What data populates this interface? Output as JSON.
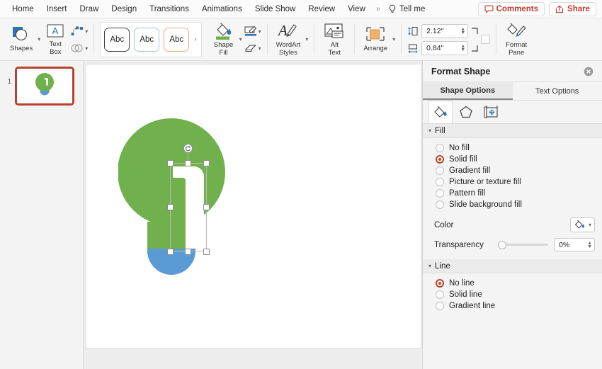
{
  "menubar": {
    "items": [
      {
        "label": "Home",
        "name": "menu-home"
      },
      {
        "label": "Insert",
        "name": "menu-insert"
      },
      {
        "label": "Draw",
        "name": "menu-draw"
      },
      {
        "label": "Design",
        "name": "menu-design"
      },
      {
        "label": "Transitions",
        "name": "menu-transitions"
      },
      {
        "label": "Animations",
        "name": "menu-animations"
      },
      {
        "label": "Slide Show",
        "name": "menu-slide-show"
      },
      {
        "label": "Review",
        "name": "menu-review"
      },
      {
        "label": "View",
        "name": "menu-view"
      }
    ],
    "overflow": "»",
    "tell_me": "Tell me",
    "comments": "Comments",
    "share": "Share",
    "accent_color": "#c0392b"
  },
  "ribbon": {
    "shapes_label": "Shapes",
    "textbox_label": "Text\nBox",
    "textbox_line1": "Text",
    "textbox_line2": "Box",
    "styles": [
      {
        "label": "Abc",
        "border": "#404040"
      },
      {
        "label": "Abc",
        "border": "#a8c3e0"
      },
      {
        "label": "Abc",
        "border": "#e8a87c"
      }
    ],
    "gallery_more": "›",
    "shape_fill_line1": "Shape",
    "shape_fill_line2": "Fill",
    "shape_fill_color": "#6fb04c",
    "wordart_line1": "WordArt",
    "wordart_line2": "Styles",
    "alt_text_line1": "Alt",
    "alt_text_line2": "Text",
    "arrange_label": "Arrange",
    "height_value": "2.12\"",
    "width_value": "0.84\"",
    "format_pane_line1": "Format",
    "format_pane_line2": "Pane"
  },
  "slide_panel": {
    "slide_number": "1",
    "selected_border_color": "#b8432a"
  },
  "canvas": {
    "bulb_green": "#70b04d",
    "bulb_blue": "#5b9bd5",
    "selection_border": "#b9b9b9"
  },
  "format_pane": {
    "title": "Format Shape",
    "close_icon": "close-icon",
    "tabs": [
      {
        "label": "Shape Options",
        "active": true
      },
      {
        "label": "Text Options",
        "active": false
      }
    ],
    "icon_tabs": [
      {
        "name": "fill-bucket-icon",
        "active": true
      },
      {
        "name": "pentagon-effects-icon",
        "active": false
      },
      {
        "name": "size-properties-icon",
        "active": false
      }
    ],
    "fill": {
      "section_title": "Fill",
      "caret": "⌄",
      "options": [
        {
          "label": "No fill",
          "selected": false
        },
        {
          "label": "Solid fill",
          "selected": true
        },
        {
          "label": "Gradient fill",
          "selected": false
        },
        {
          "label": "Picture or texture fill",
          "selected": false
        },
        {
          "label": "Pattern fill",
          "selected": false
        },
        {
          "label": "Slide background fill",
          "selected": false
        }
      ],
      "color_label": "Color",
      "transparency_label": "Transparency",
      "transparency_value": "0%"
    },
    "line": {
      "section_title": "Line",
      "caret": "⌄",
      "options": [
        {
          "label": "No line",
          "selected": true
        },
        {
          "label": "Solid line",
          "selected": false
        },
        {
          "label": "Gradient line",
          "selected": false
        }
      ]
    },
    "accent_color": "#b8432a"
  }
}
